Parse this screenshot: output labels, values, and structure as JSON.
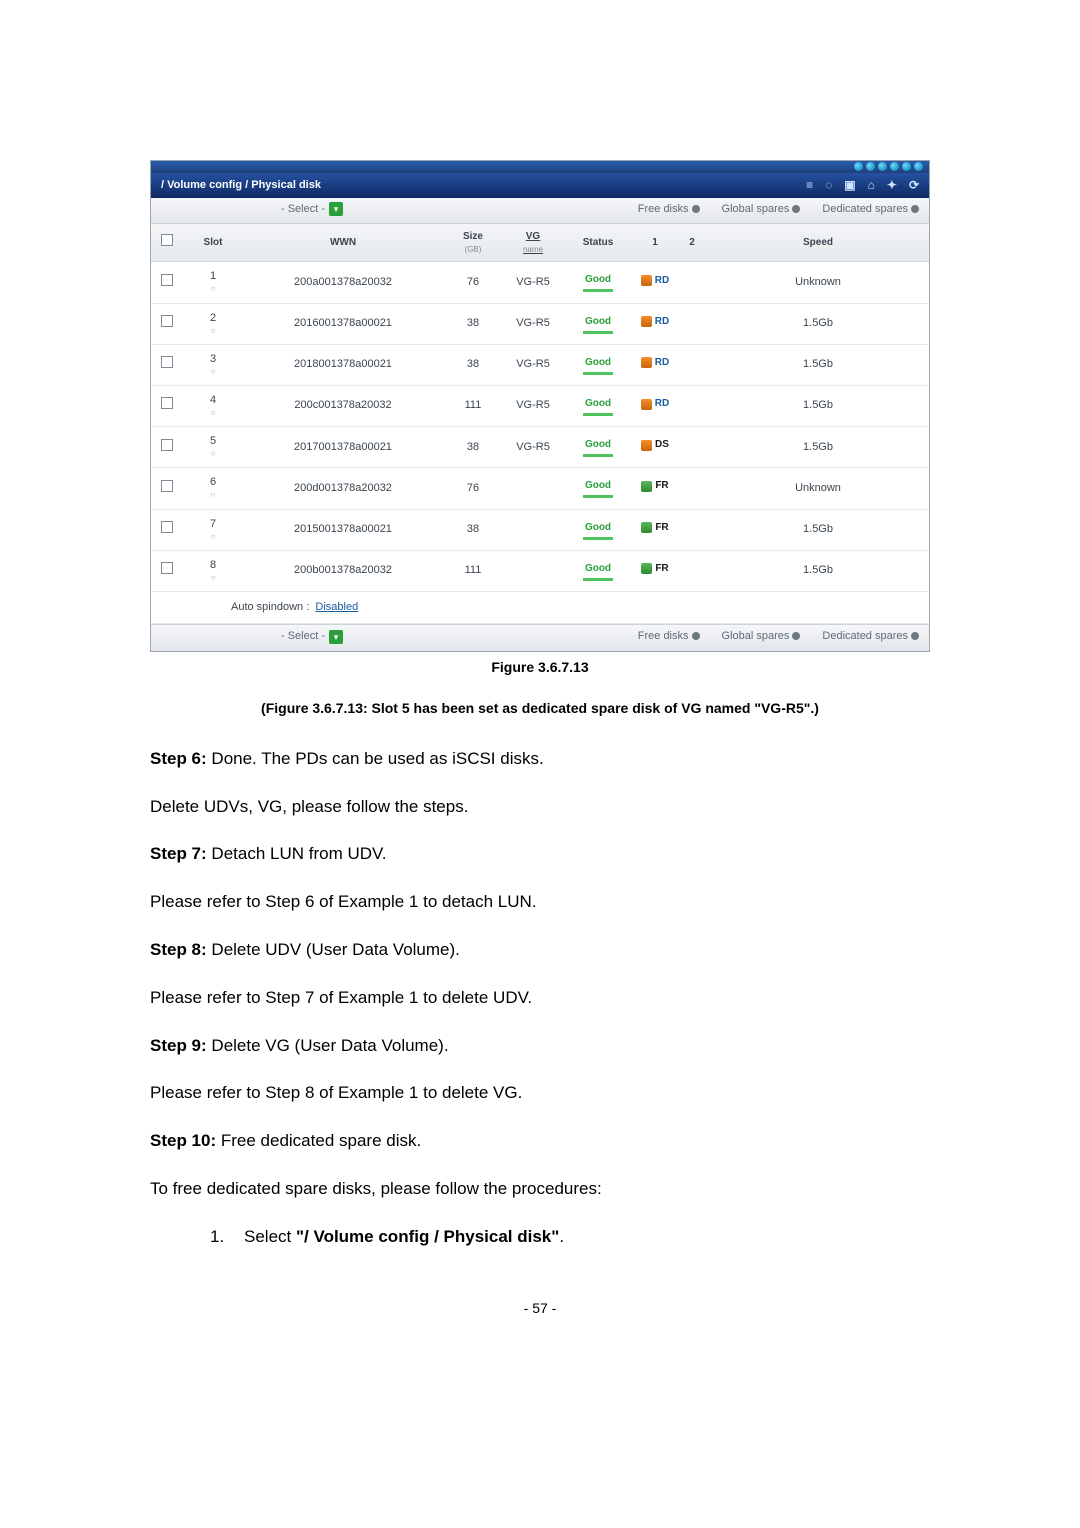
{
  "breadcrumb": "/ Volume config / Physical disk",
  "action_row": {
    "select_label": "- Select -",
    "free_disks": "Free disks",
    "global_spares": "Global spares",
    "dedicated_spares": "Dedicated spares"
  },
  "headers": {
    "slot": "Slot",
    "wwn": "WWN",
    "size": "Size",
    "size_sub": "(GB)",
    "vg": "VG",
    "vg_sub": "name",
    "status": "Status",
    "c1": "1",
    "c2": "2",
    "speed": "Speed"
  },
  "rows": [
    {
      "slot": "1",
      "wwn": "200a001378a20032",
      "size": "76",
      "vg": "VG-R5",
      "status": "Good",
      "role": "RD",
      "speed": "Unknown"
    },
    {
      "slot": "2",
      "wwn": "2016001378a00021",
      "size": "38",
      "vg": "VG-R5",
      "status": "Good",
      "role": "RD",
      "speed": "1.5Gb"
    },
    {
      "slot": "3",
      "wwn": "2018001378a00021",
      "size": "38",
      "vg": "VG-R5",
      "status": "Good",
      "role": "RD",
      "speed": "1.5Gb"
    },
    {
      "slot": "4",
      "wwn": "200c001378a20032",
      "size": "111",
      "vg": "VG-R5",
      "status": "Good",
      "role": "RD",
      "speed": "1.5Gb"
    },
    {
      "slot": "5",
      "wwn": "2017001378a00021",
      "size": "38",
      "vg": "VG-R5",
      "status": "Good",
      "role": "DS",
      "speed": "1.5Gb"
    },
    {
      "slot": "6",
      "wwn": "200d001378a20032",
      "size": "76",
      "vg": "",
      "status": "Good",
      "role": "FR",
      "speed": "Unknown"
    },
    {
      "slot": "7",
      "wwn": "2015001378a00021",
      "size": "38",
      "vg": "",
      "status": "Good",
      "role": "FR",
      "speed": "1.5Gb"
    },
    {
      "slot": "8",
      "wwn": "200b001378a20032",
      "size": "111",
      "vg": "",
      "status": "Good",
      "role": "FR",
      "speed": "1.5Gb"
    }
  ],
  "spindown": {
    "label": "Auto spindown :",
    "value": "Disabled"
  },
  "figure_label": "Figure 3.6.7.13",
  "figure_caption": "(Figure 3.6.7.13: Slot 5 has been set as dedicated spare disk of VG named \"VG-R5\".)",
  "body": {
    "step6_label": "Step 6:",
    "step6_text": " Done. The PDs can be used as iSCSI disks.",
    "delete_intro": "Delete UDVs, VG, please follow the steps.",
    "step7_label": "Step 7:",
    "step7_text": " Detach LUN from UDV.",
    "step7_note": "Please refer to Step 6 of Example 1 to detach LUN.",
    "step8_label": "Step 8:",
    "step8_text": " Delete UDV (User Data Volume).",
    "step8_note": "Please refer to Step 7 of Example 1 to delete UDV.",
    "step9_label": "Step 9:",
    "step9_text": " Delete VG (User Data Volume).",
    "step9_note": "Please refer to Step 8 of Example 1 to delete VG.",
    "step10_label": "Step 10:",
    "step10_text": " Free dedicated spare disk.",
    "step10_note": "To free dedicated spare disks, please follow the procedures:",
    "list1_num": "1.",
    "list1_pre": "Select ",
    "list1_quoted": "\"/ Volume config / Physical disk\"",
    "list1_post": "."
  },
  "page_number": "- 57 -"
}
